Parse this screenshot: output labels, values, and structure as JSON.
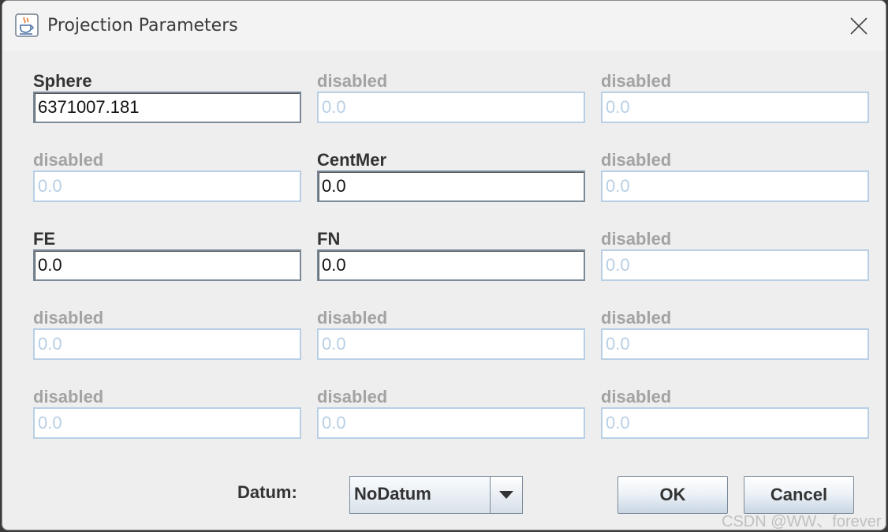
{
  "window": {
    "title": "Projection Parameters",
    "icon": "java-cup-icon",
    "close_icon": "close-icon"
  },
  "fields": [
    {
      "label": "Sphere",
      "value": "6371007.181",
      "enabled": true
    },
    {
      "label": "disabled",
      "value": "0.0",
      "enabled": false
    },
    {
      "label": "disabled",
      "value": "0.0",
      "enabled": false
    },
    {
      "label": "disabled",
      "value": "0.0",
      "enabled": false
    },
    {
      "label": "CentMer",
      "value": "0.0",
      "enabled": true
    },
    {
      "label": "disabled",
      "value": "0.0",
      "enabled": false
    },
    {
      "label": "FE",
      "value": "0.0",
      "enabled": true
    },
    {
      "label": "FN",
      "value": "0.0",
      "enabled": true
    },
    {
      "label": "disabled",
      "value": "0.0",
      "enabled": false
    },
    {
      "label": "disabled",
      "value": "0.0",
      "enabled": false
    },
    {
      "label": "disabled",
      "value": "0.0",
      "enabled": false
    },
    {
      "label": "disabled",
      "value": "0.0",
      "enabled": false
    },
    {
      "label": "disabled",
      "value": "0.0",
      "enabled": false
    },
    {
      "label": "disabled",
      "value": "0.0",
      "enabled": false
    },
    {
      "label": "disabled",
      "value": "0.0",
      "enabled": false
    }
  ],
  "datum": {
    "label": "Datum:",
    "selected": "NoDatum",
    "arrow_icon": "chevron-down-icon"
  },
  "buttons": {
    "ok": "OK",
    "cancel": "Cancel"
  },
  "watermark": "CSDN @WW、forever",
  "colors": {
    "enabled_text": "#333333",
    "disabled_text": "#a3a3a3",
    "disabled_border": "#b8cfe5",
    "background": "#eeeeee"
  }
}
